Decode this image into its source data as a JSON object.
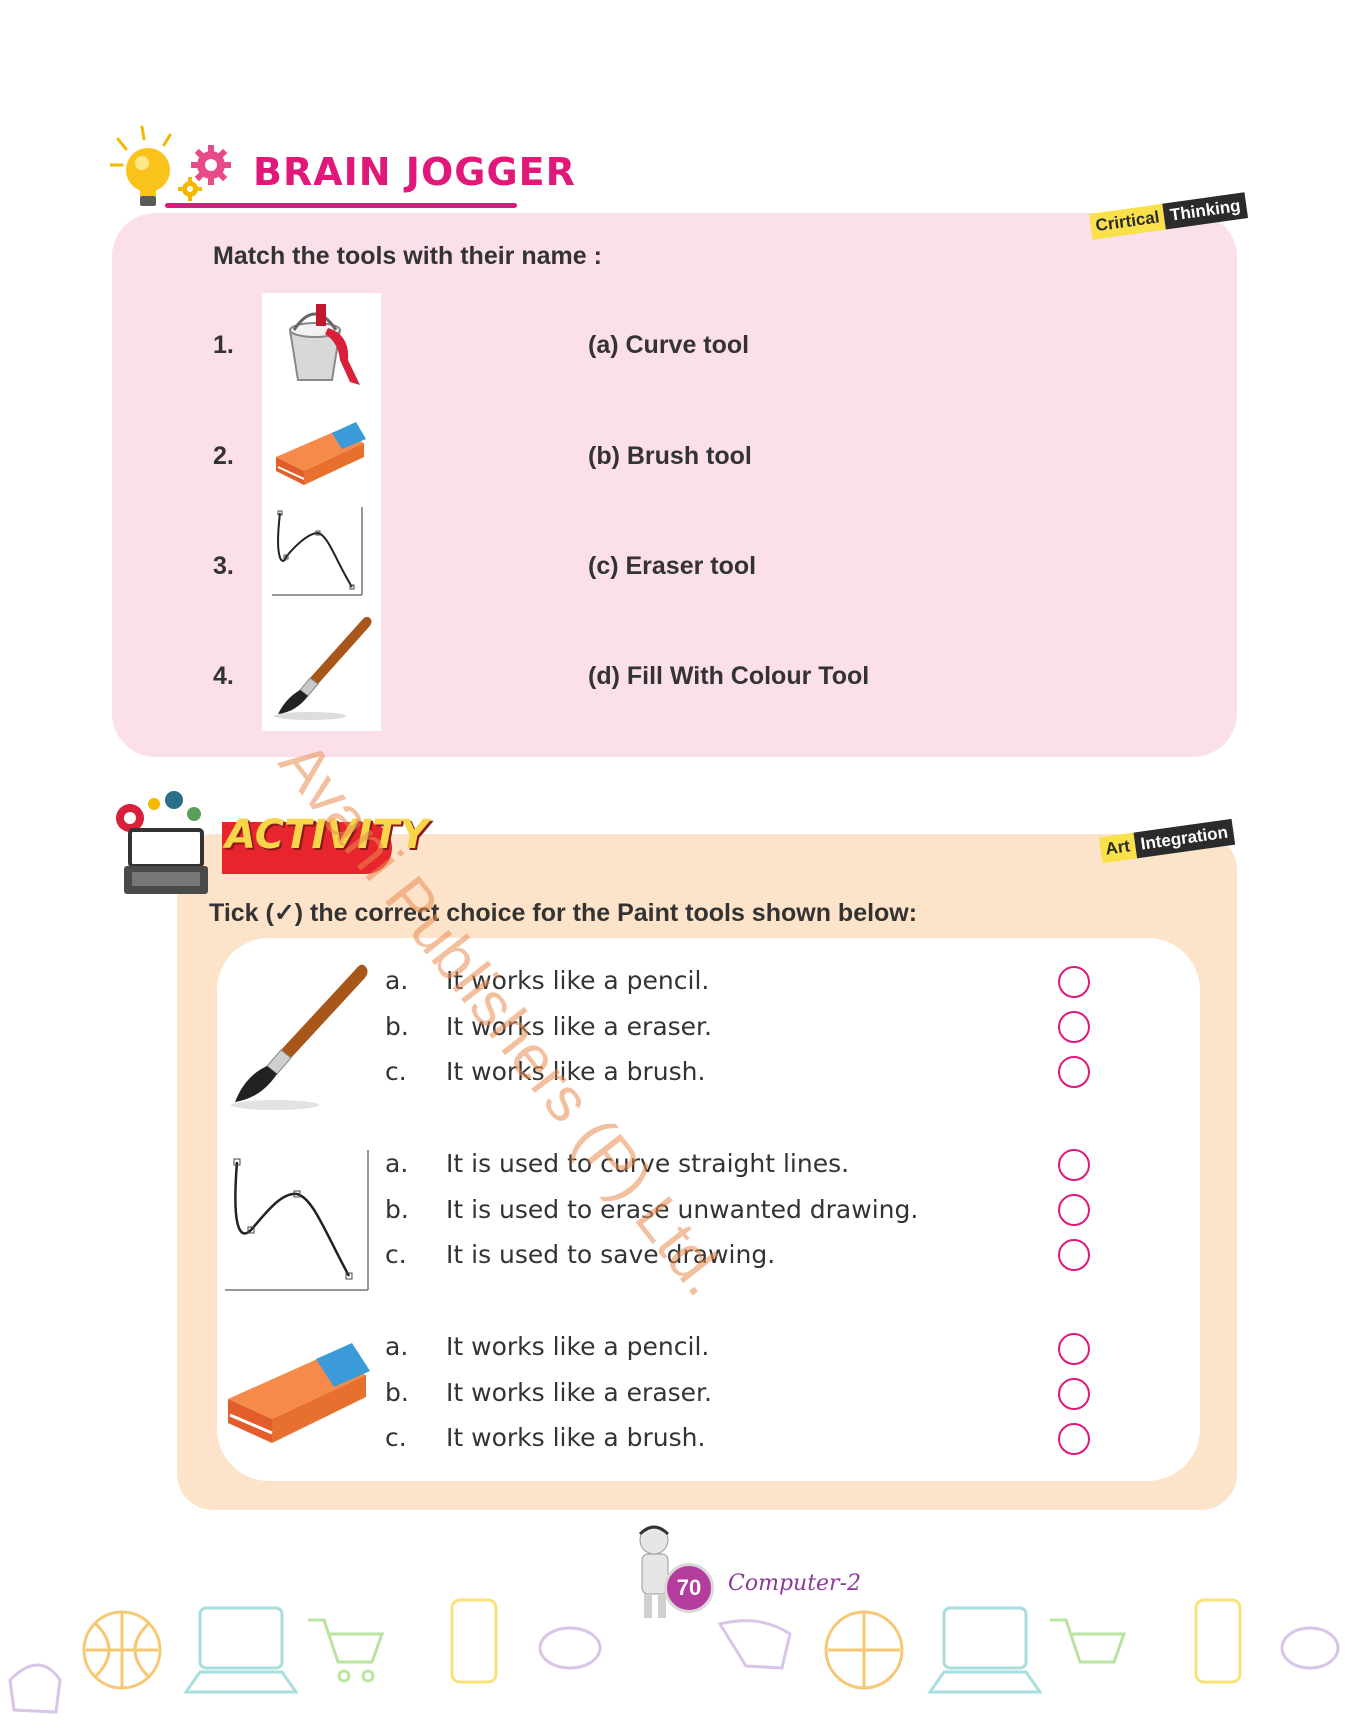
{
  "brain_jogger": {
    "title": "BRAIN JOGGER",
    "tag_part1": "Crirtical",
    "tag_part2": "Thinking",
    "question": "Match the tools with their name :",
    "items": [
      {
        "num": "1.",
        "icon": "paint-bucket-icon",
        "option": "(a) Curve tool"
      },
      {
        "num": "2.",
        "icon": "eraser-icon",
        "option": "(b) Brush tool"
      },
      {
        "num": "3.",
        "icon": "curve-icon",
        "option": "(c) Eraser tool"
      },
      {
        "num": "4.",
        "icon": "brush-icon",
        "option": "(d) Fill With Colour Tool"
      }
    ]
  },
  "activity": {
    "title": "ACTIVITY",
    "tag_part1": "Art",
    "tag_part2": "Integration",
    "instruction": "Tick (✓) the correct choice for the Paint tools shown below:",
    "groups": [
      {
        "icon": "brush-icon",
        "choices": [
          {
            "letter": "a.",
            "text": "It works like a pencil."
          },
          {
            "letter": "b.",
            "text": "It works like a eraser."
          },
          {
            "letter": "c.",
            "text": "It works like a brush."
          }
        ]
      },
      {
        "icon": "curve-icon",
        "choices": [
          {
            "letter": "a.",
            "text": "It is used to curve straight lines."
          },
          {
            "letter": "b.",
            "text": "It is used to erase unwanted drawing."
          },
          {
            "letter": "c.",
            "text": "It is used to save drawing."
          }
        ]
      },
      {
        "icon": "eraser-icon",
        "choices": [
          {
            "letter": "a.",
            "text": "It works like a pencil."
          },
          {
            "letter": "b.",
            "text": "It works like a eraser."
          },
          {
            "letter": "c.",
            "text": "It works like a brush."
          }
        ]
      }
    ]
  },
  "watermark": "Avani Publishers (P) Ltd.",
  "footer": {
    "page_number": "70",
    "book_title": "Computer-2"
  },
  "colors": {
    "accent_pink": "#e0187a",
    "panel_pink": "#fbdfea",
    "panel_peach": "#fde3c9"
  }
}
